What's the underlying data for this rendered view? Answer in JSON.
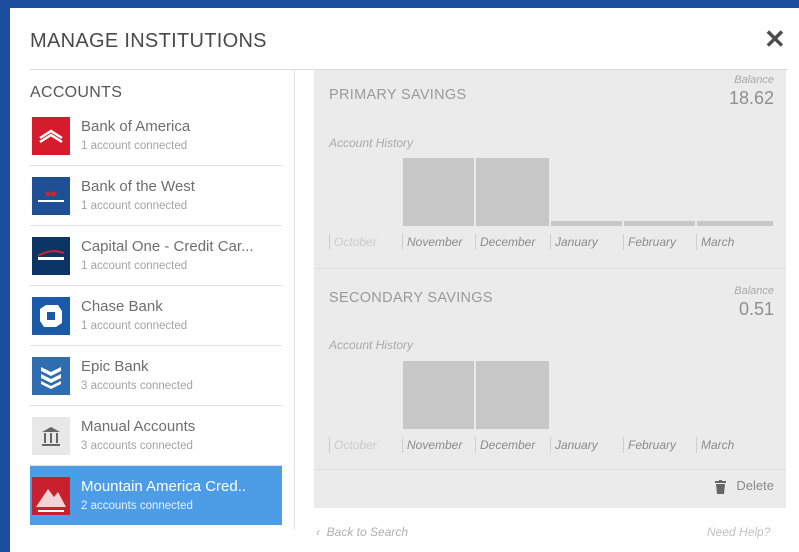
{
  "header": {
    "title": "MANAGE INSTITUTIONS",
    "close_icon": "close-icon"
  },
  "sidebar": {
    "title": "ACCOUNTS",
    "items": [
      {
        "name": "Bank of America",
        "sub": "1 account connected",
        "icon": "bank-of-america-logo",
        "color": "#d61c2c"
      },
      {
        "name": "Bank of the West",
        "sub": "1 account connected",
        "icon": "bank-of-the-west-logo",
        "color": "#1f4f95"
      },
      {
        "name": "Capital One - Credit Car...",
        "sub": "1 account connected",
        "icon": "capital-one-logo",
        "color": "#0b3566"
      },
      {
        "name": "Chase Bank",
        "sub": "1 account connected",
        "icon": "chase-logo",
        "color": "#1a5aa6"
      },
      {
        "name": "Epic Bank",
        "sub": "3 accounts connected",
        "icon": "epic-bank-logo",
        "color": "#2f6db0"
      },
      {
        "name": "Manual Accounts",
        "sub": "3 accounts connected",
        "icon": "bank-building-icon",
        "color": "#e8e8e8"
      },
      {
        "name": "Mountain America Cred..",
        "sub": "2 accounts connected",
        "icon": "mountain-america-logo",
        "color": "#c9202f",
        "selected": true
      }
    ]
  },
  "accounts": [
    {
      "title": "PRIMARY SAVINGS",
      "balance_label": "Balance",
      "balance": "18.62",
      "history_label": "Account History",
      "months": [
        "October",
        "November",
        "December",
        "January",
        "February",
        "March"
      ],
      "history_levels": [
        0,
        1.0,
        1.0,
        0.07,
        0.07,
        0.07
      ]
    },
    {
      "title": "SECONDARY SAVINGS",
      "balance_label": "Balance",
      "balance": "0.51",
      "history_label": "Account History",
      "months": [
        "October",
        "November",
        "December",
        "January",
        "February",
        "March"
      ],
      "history_levels": [
        0,
        1.0,
        1.0,
        0,
        0,
        0
      ]
    }
  ],
  "actions": {
    "delete_label": "Delete",
    "back_label": "Back to Search",
    "help_label": "Need Help?"
  }
}
